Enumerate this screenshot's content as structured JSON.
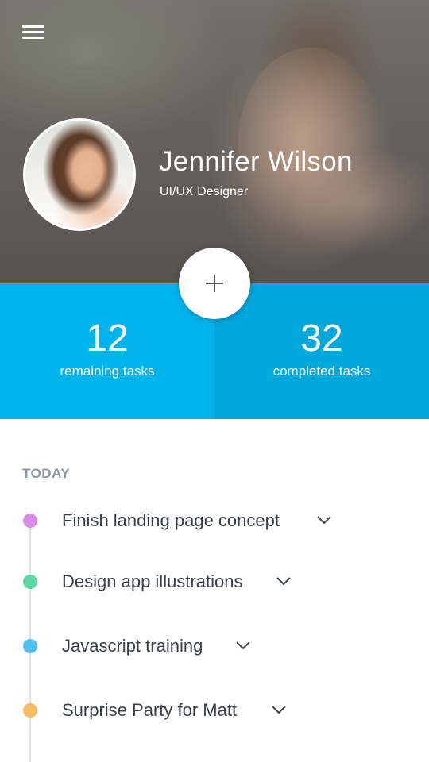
{
  "header": {
    "profile": {
      "name": "Jennifer Wilson",
      "role": "UI/UX Designer"
    },
    "menu_icon": "hamburger-menu-icon",
    "add_icon": "plus-icon"
  },
  "stats": {
    "remaining": {
      "value": "12",
      "label": "remaining tasks"
    },
    "completed": {
      "value": "32",
      "label": "completed tasks"
    }
  },
  "tasks_section": {
    "title": "TODAY",
    "items": [
      {
        "label": "Finish landing page concept",
        "color": "#d88ce8",
        "icon": "chevron-down-icon"
      },
      {
        "label": "Design app illustrations",
        "color": "#5cd9a0",
        "icon": "chevron-down-icon"
      },
      {
        "label": "Javascript training",
        "color": "#4fc0f5",
        "icon": "chevron-down-icon"
      },
      {
        "label": "Surprise Party for Matt",
        "color": "#f7bc62",
        "icon": "chevron-down-icon"
      }
    ]
  },
  "colors": {
    "stat_left_bg": "#00b4ec",
    "stat_right_bg": "#00a8dc",
    "section_title": "#8a96a3",
    "task_text": "#3a3f47"
  }
}
